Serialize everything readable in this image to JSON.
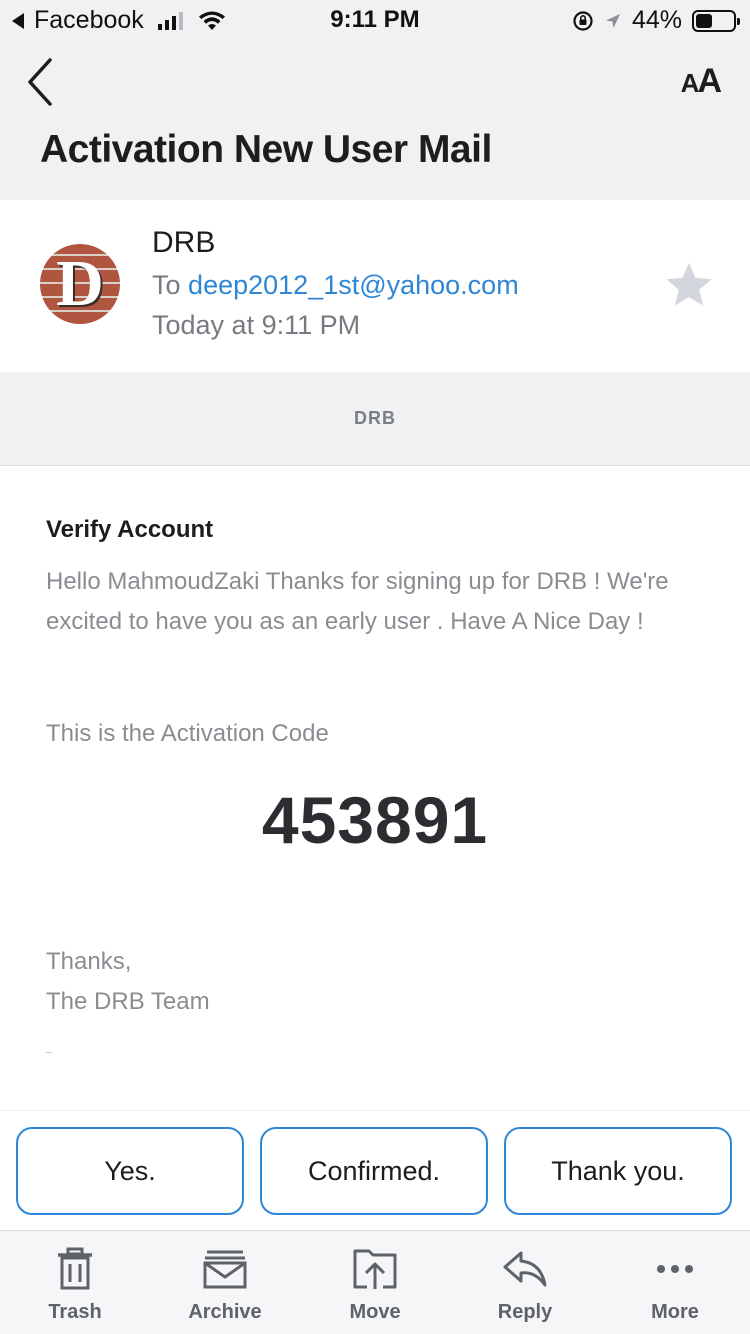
{
  "status_bar": {
    "back_app": "Facebook",
    "time": "9:11 PM",
    "battery_percent": "44%",
    "battery_level": 0.44
  },
  "header": {
    "title": "Activation New User Mail",
    "text_size_label_small": "A",
    "text_size_label_big": "A"
  },
  "sender": {
    "avatar_letter": "D",
    "name": "DRB",
    "to_prefix": "To",
    "to_email": "deep2012_1st@yahoo.com",
    "date": "Today at 9:11 PM"
  },
  "brand_band": {
    "label": "DRB"
  },
  "body": {
    "heading": "Verify Account",
    "paragraph": "Hello MahmoudZaki Thanks for signing up for DRB ! We're excited to have you as an early user . Have A Nice Day !",
    "code_label": "This is the Activation Code",
    "code": "453891",
    "thanks_line1": "Thanks,",
    "thanks_line2": "The DRB Team"
  },
  "quick_replies": [
    "Yes.",
    "Confirmed.",
    "Thank you."
  ],
  "toolbar": {
    "trash": "Trash",
    "archive": "Archive",
    "move": "Move",
    "reply": "Reply",
    "more": "More"
  },
  "colors": {
    "accent": "#2e86d6",
    "header_bg": "#f0f1f3",
    "body_text": "#8a8c91"
  }
}
